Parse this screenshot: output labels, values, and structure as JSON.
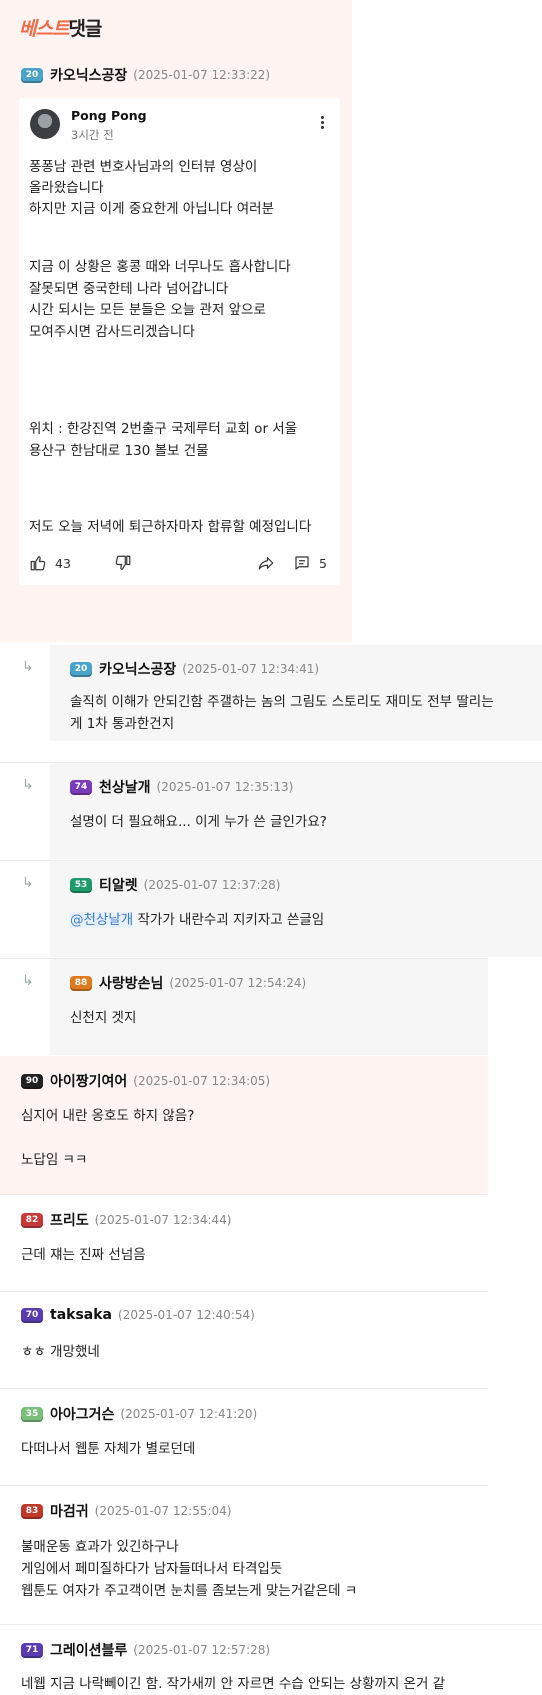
{
  "best_label": {
    "part1": "베스트",
    "part2": "댓글"
  },
  "best_comment": {
    "nick": "카오닉스공장",
    "level": "20",
    "date": "(2025-01-07 12:33:22)",
    "level_color": "#4aa3c8",
    "card": {
      "author": "Pong Pong",
      "time": "3시간 전",
      "lines": [
        "퐁퐁남 관련 변호사님과의 인터뷰 영상이",
        "올라왔습니다",
        "하지만 지금 이게 중요한게 아닙니다 여러분",
        "지금 이 상황은 홍콩 때와 너무나도 흡사합니다",
        "잘못되면 중국한테 나라 넘어갑니다",
        "시간 되시는 모든 분들은 오늘 관저 앞으로",
        "모여주시면 감사드리겠습니다",
        "위치 : 한강진역 2번출구 국제루터 교회 or  서울",
        "용산구 한남대로 130 볼보 건물",
        "저도 오늘 저녁에  퇴근하자마자 합류할 예정입니다"
      ],
      "likes": "43",
      "replies": "5"
    }
  },
  "replies": [
    {
      "nick": "카오닉스공장",
      "level": "20",
      "level_color": "#4aa3c8",
      "date": "(2025-01-07 12:34:41)",
      "lines": [
        "솔직히 이해가 안되긴함 주갤하는 놈의 그림도 스토리도 재미도 전부 딸리는",
        "게 1차 통과한건지"
      ]
    },
    {
      "nick": "천상날개",
      "level": "74",
      "level_color": "#7a3bb8",
      "date": "(2025-01-07 12:35:13)",
      "lines": [
        "설명이 더 필요해요... 이게 누가 쓴 글인가요?"
      ]
    },
    {
      "nick": "티알렛",
      "level": "53",
      "level_color": "#1f9a6a",
      "date": "(2025-01-07 12:37:28)",
      "mention": "@천상날개",
      "lines": [
        " 작가가 내란수괴 지키자고 쓴글임"
      ]
    },
    {
      "nick": "사랑방손님",
      "level": "88",
      "level_color": "#e07a1f",
      "date": "(2025-01-07 12:54:24)",
      "lines": [
        "신천지 겟지"
      ]
    }
  ],
  "comments": [
    {
      "nick": "아이짱기여어",
      "level": "90",
      "level_color": "#222222",
      "date": "(2025-01-07 12:34:05)",
      "lines": [
        "심지어 내란 옹호도 하지 않음?",
        "",
        "노답임 ㅋㅋ"
      ],
      "highlight": true
    },
    {
      "nick": "프리도",
      "level": "82",
      "level_color": "#c83a3a",
      "date": "(2025-01-07 12:34:44)",
      "lines": [
        "근데 쟤는 진짜 선넘음"
      ]
    },
    {
      "nick": "taksaka",
      "level": "70",
      "level_color": "#5a3bb0",
      "date": "(2025-01-07 12:40:54)",
      "lines": [
        "ㅎㅎ 개망했네"
      ]
    },
    {
      "nick": "아아그거슨",
      "level": "35",
      "level_color": "#7cbf7c",
      "date": "(2025-01-07 12:41:20)",
      "lines": [
        "다떠나서 웹툰 자체가 별로던데"
      ]
    },
    {
      "nick": "마검귀",
      "level": "83",
      "level_color": "#c0392b",
      "date": "(2025-01-07 12:55:04)",
      "lines": [
        "불매운동 효과가 있긴하구나",
        "게임에서 페미질하다가 남자들떠나서 타격입듯",
        "웹툰도 여자가 주고객이면 눈치를 좀보는게 맞는거같은데 ㅋ"
      ]
    },
    {
      "nick": "그레이션블루",
      "level": "71",
      "level_color": "#5a3bb0",
      "date": "(2025-01-07 12:57:28)",
      "lines": [
        "네웹 지금 나락뻬이긴 함. 작가새끼 안 자르면 수습 안되는 상황까지 온거 같"
      ]
    }
  ]
}
